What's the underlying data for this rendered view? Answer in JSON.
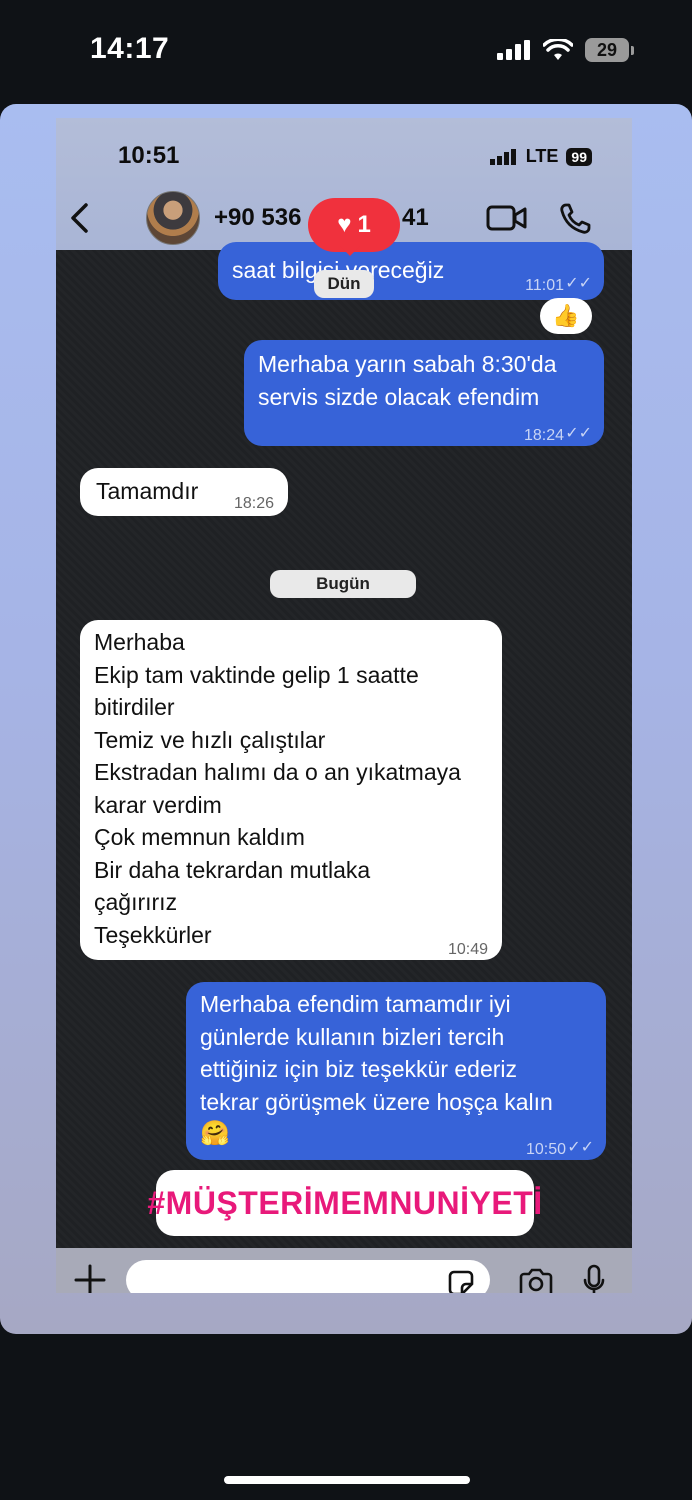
{
  "outer_status": {
    "time": "14:17",
    "battery": "29"
  },
  "inner_status": {
    "time": "10:51",
    "network": "LTE",
    "battery": "99"
  },
  "header": {
    "phone_prefix": "+90 536",
    "phone_suffix": "41"
  },
  "like_badge": {
    "count": "1"
  },
  "messages": [
    {
      "dir": "out",
      "text": "saat bilgisi vereceğiz",
      "time": "11:01"
    },
    {
      "dir": "out",
      "text": "Merhaba yarın sabah 8:30'da\nservis sizde olacak efendim",
      "time": "18:24"
    },
    {
      "dir": "in",
      "text": "Tamamdır",
      "time": "18:26"
    },
    {
      "dir": "in",
      "text": "Merhaba\nEkip tam vaktinde gelip 1 saatte\nbitirdiler\nTemiz ve hızlı çalıştılar\nEkstradan halımı da o an yıkatmaya\nkarar verdim\nÇok memnun kaldım\nBir daha tekrardan mutlaka\nçağırırız\nTeşekkürler",
      "time": "10:49"
    },
    {
      "dir": "out",
      "text": "Merhaba efendim tamamdır iyi\ngünlerde kullanın bizleri tercih\nettiğiniz için biz teşekkür ederiz\ntekrar görüşmek üzere hoşça kalın",
      "emoji": "🤗",
      "time": "10:50"
    }
  ],
  "dates": {
    "yesterday": "Dün",
    "today": "Bugün"
  },
  "reaction": "👍",
  "hashtag": "#MÜŞTERİMEMNUNİYETİ",
  "colors": {
    "outgoing": "#3763d8",
    "incoming": "#ffffff",
    "like": "#f0313d",
    "hashtag": "#e8197a"
  }
}
